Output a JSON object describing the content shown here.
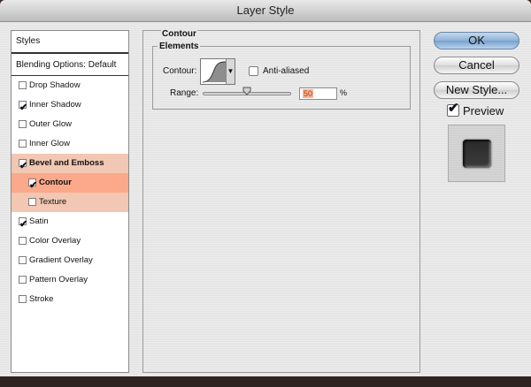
{
  "window": {
    "title": "Layer Style"
  },
  "styles_panel": {
    "header": "Styles",
    "blending_options": "Blending Options: Default",
    "items": [
      {
        "label": "Drop Shadow",
        "checked": false,
        "level": 0,
        "bold": false,
        "highlight": "none"
      },
      {
        "label": "Inner Shadow",
        "checked": true,
        "level": 0,
        "bold": false,
        "highlight": "none"
      },
      {
        "label": "Outer Glow",
        "checked": false,
        "level": 0,
        "bold": false,
        "highlight": "none"
      },
      {
        "label": "Inner Glow",
        "checked": false,
        "level": 0,
        "bold": false,
        "highlight": "none"
      },
      {
        "label": "Bevel and Emboss",
        "checked": true,
        "level": 0,
        "bold": true,
        "highlight": "light"
      },
      {
        "label": "Contour",
        "checked": true,
        "level": 1,
        "bold": true,
        "highlight": "strong"
      },
      {
        "label": "Texture",
        "checked": false,
        "level": 1,
        "bold": false,
        "highlight": "light"
      },
      {
        "label": "Satin",
        "checked": true,
        "level": 0,
        "bold": false,
        "highlight": "none"
      },
      {
        "label": "Color Overlay",
        "checked": false,
        "level": 0,
        "bold": false,
        "highlight": "none"
      },
      {
        "label": "Gradient Overlay",
        "checked": false,
        "level": 0,
        "bold": false,
        "highlight": "none"
      },
      {
        "label": "Pattern Overlay",
        "checked": false,
        "level": 0,
        "bold": false,
        "highlight": "none"
      },
      {
        "label": "Stroke",
        "checked": false,
        "level": 0,
        "bold": false,
        "highlight": "none"
      }
    ]
  },
  "contour_panel": {
    "title": "Contour",
    "elements_title": "Elements",
    "contour_label": "Contour:",
    "anti_aliased_label": "Anti-aliased",
    "anti_aliased_checked": false,
    "range_label": "Range:",
    "range_value": "50",
    "range_unit": "%",
    "range_percent": 50
  },
  "buttons": {
    "ok": "OK",
    "cancel": "Cancel",
    "new_style": "New Style..."
  },
  "preview": {
    "label": "Preview",
    "checked": true
  },
  "colors": {
    "highlight_light": "#f2c7b3",
    "highlight_strong": "#fba98a",
    "ok_button": "#8fb1d7"
  }
}
